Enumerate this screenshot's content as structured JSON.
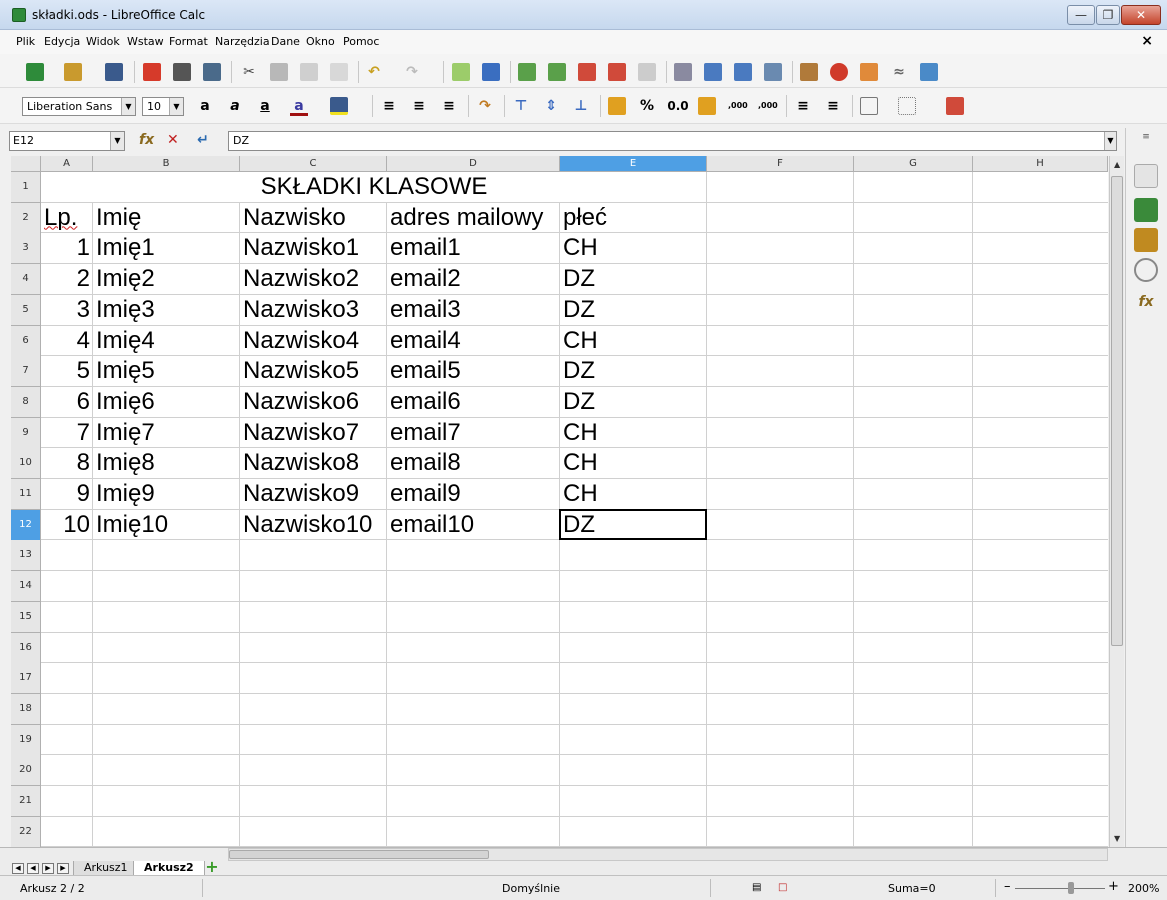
{
  "window": {
    "title": "składki.ods - LibreOffice Calc"
  },
  "menu": [
    "Plik",
    "Edycja",
    "Widok",
    "Wstaw",
    "Format",
    "Narzędzia",
    "Dane",
    "Okno",
    "Pomoc"
  ],
  "format_toolbar": {
    "font_name": "Liberation Sans",
    "font_size": "10",
    "percent": "%",
    "number": "0.0",
    "add_decimal": ",000",
    "del_decimal": ",000"
  },
  "formula_bar": {
    "cell_ref": "E12",
    "content": "DZ"
  },
  "columns": [
    "A",
    "B",
    "C",
    "D",
    "E",
    "F",
    "G",
    "H"
  ],
  "selected_column": "E",
  "rows": [
    "1",
    "2",
    "3",
    "4",
    "5",
    "6",
    "7",
    "8",
    "9",
    "10",
    "11",
    "12",
    "13",
    "14",
    "15",
    "16",
    "17",
    "18",
    "19",
    "20",
    "21",
    "22"
  ],
  "selected_row": "12",
  "sheet": {
    "title": "SKŁADKI KLASOWE",
    "headers": [
      "Lp.",
      "Imię",
      "Nazwisko",
      "adres mailowy",
      "płeć"
    ],
    "data": [
      [
        "1",
        "Imię1",
        "Nazwisko1",
        "email1",
        "CH"
      ],
      [
        "2",
        "Imię2",
        "Nazwisko2",
        "email2",
        "DZ"
      ],
      [
        "3",
        "Imię3",
        "Nazwisko3",
        "email3",
        "DZ"
      ],
      [
        "4",
        "Imię4",
        "Nazwisko4",
        "email4",
        "CH"
      ],
      [
        "5",
        "Imię5",
        "Nazwisko5",
        "email5",
        "DZ"
      ],
      [
        "6",
        "Imię6",
        "Nazwisko6",
        "email6",
        "DZ"
      ],
      [
        "7",
        "Imię7",
        "Nazwisko7",
        "email7",
        "CH"
      ],
      [
        "8",
        "Imię8",
        "Nazwisko8",
        "email8",
        "CH"
      ],
      [
        "9",
        "Imię9",
        "Nazwisko9",
        "email9",
        "CH"
      ],
      [
        "10",
        "Imię10",
        "Nazwisko10",
        "email10",
        "DZ"
      ]
    ]
  },
  "tabs": [
    "Arkusz1",
    "Arkusz2"
  ],
  "active_tab": "Arkusz2",
  "status": {
    "sheet": "Arkusz 2 / 2",
    "style": "Domyślnie",
    "sum": "Suma=0",
    "zoom": "200%"
  },
  "colors": {
    "selection": "#4e9fe4",
    "spell_error": "#d02020"
  }
}
